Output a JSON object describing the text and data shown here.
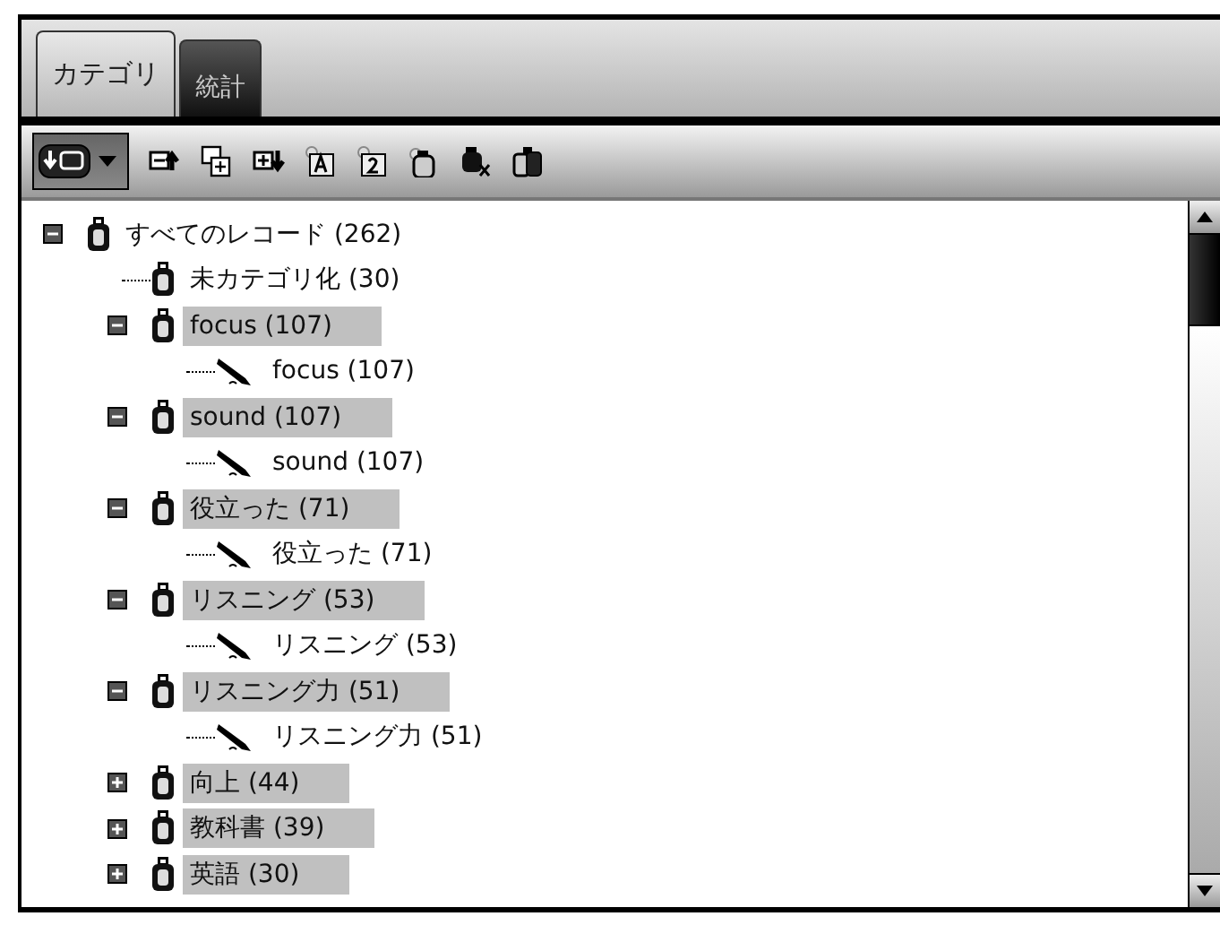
{
  "tabs": [
    {
      "label": "カテゴリ",
      "selected": true
    },
    {
      "label": "統計",
      "selected": false
    }
  ],
  "tree": [
    {
      "label": "すべてのレコード (262)",
      "kind": "category",
      "expanded": true,
      "highlighted": false,
      "children": [
        {
          "label": "未カテゴリ化 (30)",
          "kind": "category",
          "highlighted": false
        },
        {
          "label": "focus (107)",
          "kind": "category",
          "expanded": true,
          "highlighted": true,
          "children": [
            {
              "label": "focus (107)",
              "kind": "tag",
              "highlighted": false
            }
          ]
        },
        {
          "label": "sound (107)",
          "kind": "category",
          "expanded": true,
          "highlighted": true,
          "children": [
            {
              "label": "sound (107)",
              "kind": "tag",
              "highlighted": false
            }
          ]
        },
        {
          "label": "役立った (71)",
          "kind": "category",
          "expanded": true,
          "highlighted": true,
          "children": [
            {
              "label": "役立った (71)",
              "kind": "tag",
              "highlighted": false
            }
          ]
        },
        {
          "label": "リスニング (53)",
          "kind": "category",
          "expanded": true,
          "highlighted": true,
          "children": [
            {
              "label": "リスニング (53)",
              "kind": "tag",
              "highlighted": false
            }
          ]
        },
        {
          "label": "リスニング力 (51)",
          "kind": "category",
          "expanded": true,
          "highlighted": true,
          "children": [
            {
              "label": "リスニング力 (51)",
              "kind": "tag",
              "highlighted": false
            }
          ]
        },
        {
          "label": "向上 (44)",
          "kind": "category",
          "expanded": false,
          "highlighted": true
        },
        {
          "label": "教科書 (39)",
          "kind": "category",
          "expanded": false,
          "highlighted": true
        },
        {
          "label": "英語 (30)",
          "kind": "category",
          "expanded": false,
          "highlighted": true
        }
      ]
    }
  ]
}
